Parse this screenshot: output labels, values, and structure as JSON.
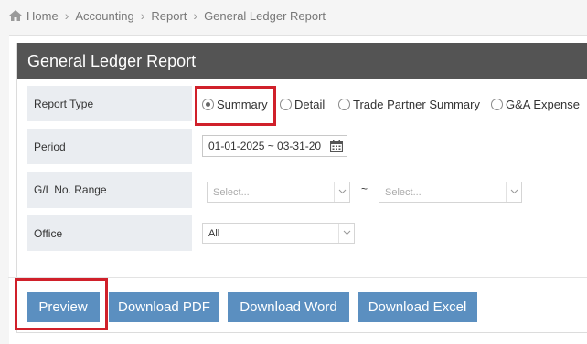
{
  "breadcrumb": [
    "Home",
    "Accounting",
    "Report",
    "General Ledger Report"
  ],
  "panel_title": "General Ledger Report",
  "fields": {
    "report_type": {
      "label": "Report Type",
      "options": [
        "Summary",
        "Detail",
        "Trade Partner Summary",
        "G&A Expense"
      ],
      "selected": "Summary"
    },
    "period": {
      "label": "Period",
      "value": "01-01-2025 ~ 03-31-20"
    },
    "gl_range": {
      "label": "G/L No. Range",
      "from_placeholder": "Select...",
      "separator": "~",
      "to_placeholder": "Select..."
    },
    "office": {
      "label": "Office",
      "value": "All"
    }
  },
  "buttons": {
    "preview": "Preview",
    "pdf": "Download PDF",
    "word": "Download Word",
    "excel": "Download Excel"
  },
  "colors": {
    "header_bg": "#545454",
    "label_bg": "#eaedf1",
    "button_bg": "#5b8fc0",
    "highlight": "#d0202a"
  },
  "icons": {
    "home": "home-icon",
    "calendar": "calendar-icon",
    "dropdown": "chevron-down-icon"
  }
}
